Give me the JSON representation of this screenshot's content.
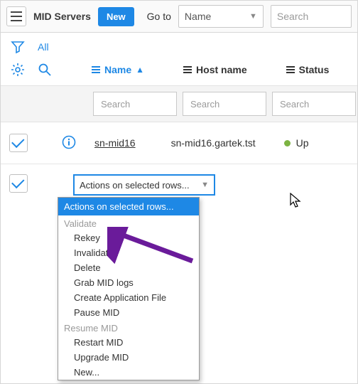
{
  "topbar": {
    "title": "MID Servers",
    "new_label": "New",
    "goto_label": "Go to",
    "goto_field": "Name",
    "search_placeholder": "Search"
  },
  "filter": {
    "all_label": "All"
  },
  "columns": {
    "name": "Name",
    "host": "Host name",
    "status": "Status",
    "search_placeholder": "Search"
  },
  "row": {
    "name": "sn-mid16",
    "host": "sn-mid16.gartek.tst",
    "status": "Up"
  },
  "actions": {
    "select_label": "Actions on selected rows...",
    "header": "Actions on selected rows...",
    "group_validate": "Validate",
    "items_validate": [
      "Rekey",
      "Invalidate",
      "Delete",
      "Grab MID logs",
      "Create Application File",
      "Pause MID"
    ],
    "group_resume": "Resume MID",
    "items_resume": [
      "Restart MID",
      "Upgrade MID",
      "New..."
    ]
  },
  "colors": {
    "accent": "#1e88e5",
    "status_up": "#7cb342",
    "annotation": "#6a1b9a"
  }
}
